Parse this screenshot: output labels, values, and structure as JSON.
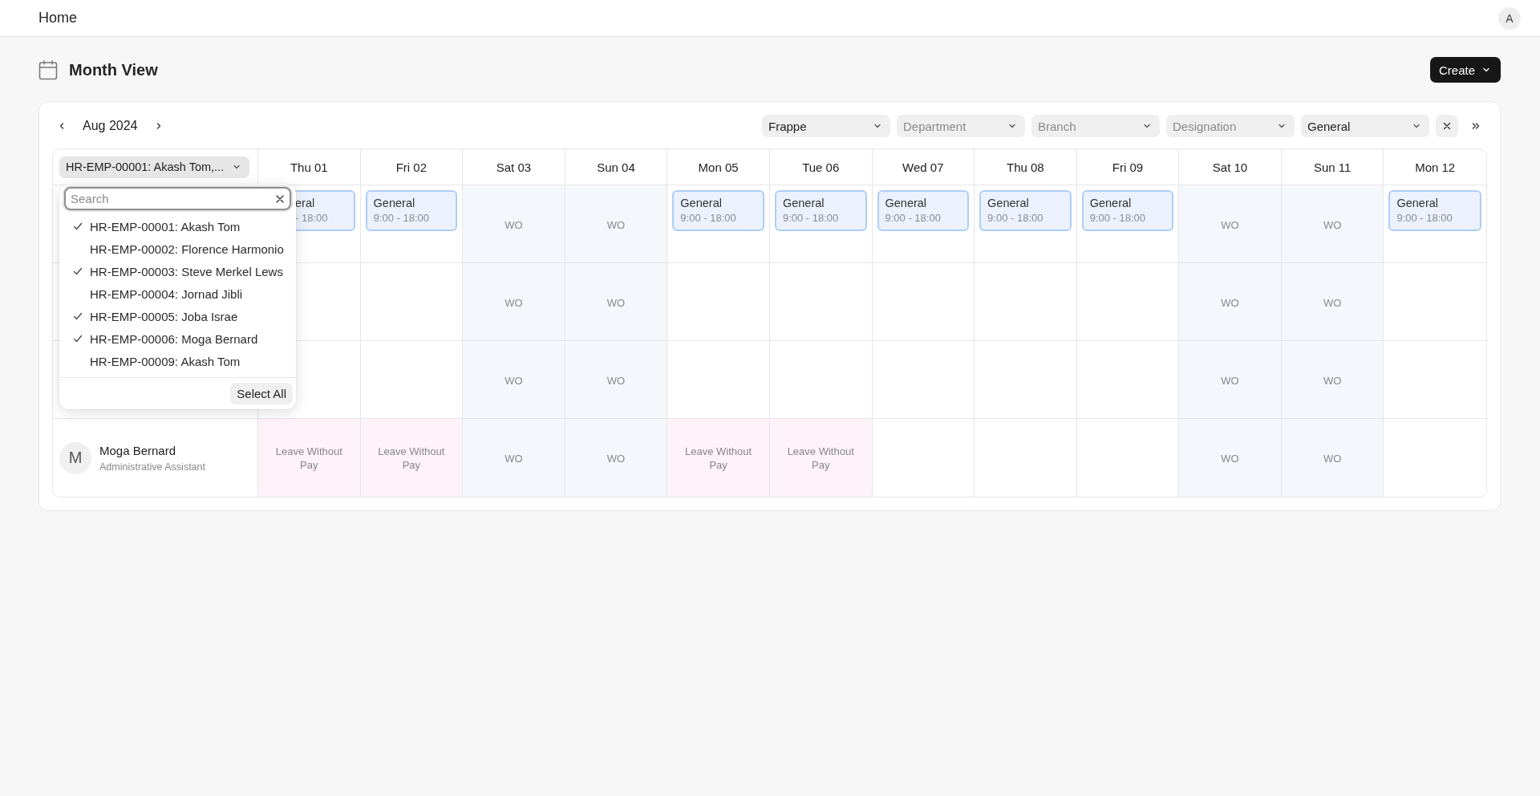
{
  "topbar": {
    "title": "Home",
    "avatar": "A"
  },
  "page": {
    "title": "Month View",
    "create_button": "Create"
  },
  "toolbar": {
    "month": "Aug 2024",
    "filters": [
      {
        "value": "Frappe"
      },
      {
        "placeholder": "Department"
      },
      {
        "placeholder": "Branch"
      },
      {
        "placeholder": "Designation"
      },
      {
        "value": "General"
      }
    ]
  },
  "employee_filter": {
    "value": "HR-EMP-00001: Akash Tom,...",
    "expanded": true,
    "search_placeholder": "Search",
    "options": [
      {
        "label": "HR-EMP-00001: Akash Tom",
        "checked": true
      },
      {
        "label": "HR-EMP-00002: Florence Harmonio",
        "checked": false
      },
      {
        "label": "HR-EMP-00003: Steve Merkel Lews",
        "checked": true
      },
      {
        "label": "HR-EMP-00004: Jornad Jibli",
        "checked": false
      },
      {
        "label": "HR-EMP-00005: Joba Israe",
        "checked": true
      },
      {
        "label": "HR-EMP-00006: Moga Bernard",
        "checked": true
      },
      {
        "label": "HR-EMP-00009: Akash Tom",
        "checked": false
      }
    ],
    "select_all": "Select All"
  },
  "columns": [
    "Thu 01",
    "Fri 02",
    "Sat 03",
    "Sun 04",
    "Mon 05",
    "Tue 06",
    "Wed 07",
    "Thu 08",
    "Fri 09",
    "Sat 10",
    "Sun 11",
    "Mon 12"
  ],
  "rows": [
    {
      "cells": [
        {
          "kind": "shift",
          "label": "eral",
          "time": "- 18:00"
        },
        {
          "kind": "shift",
          "label": "General",
          "time": "9:00 - 18:00"
        },
        {
          "kind": "off",
          "label": "WO"
        },
        {
          "kind": "off",
          "label": "WO"
        },
        {
          "kind": "shift",
          "label": "General",
          "time": "9:00 - 18:00"
        },
        {
          "kind": "shift",
          "label": "General",
          "time": "9:00 - 18:00"
        },
        {
          "kind": "shift",
          "label": "General",
          "time": "9:00 - 18:00"
        },
        {
          "kind": "shift",
          "label": "General",
          "time": "9:00 - 18:00"
        },
        {
          "kind": "shift",
          "label": "General",
          "time": "9:00 - 18:00"
        },
        {
          "kind": "off",
          "label": "WO"
        },
        {
          "kind": "off",
          "label": "WO"
        },
        {
          "kind": "shift",
          "label": "General",
          "time": "9:00 - 18:00"
        }
      ]
    },
    {
      "cells": [
        {
          "kind": "empty"
        },
        {
          "kind": "empty"
        },
        {
          "kind": "off",
          "label": "WO"
        },
        {
          "kind": "off",
          "label": "WO"
        },
        {
          "kind": "empty"
        },
        {
          "kind": "empty"
        },
        {
          "kind": "empty"
        },
        {
          "kind": "empty"
        },
        {
          "kind": "empty"
        },
        {
          "kind": "off",
          "label": "WO"
        },
        {
          "kind": "off",
          "label": "WO"
        },
        {
          "kind": "empty"
        }
      ]
    },
    {
      "cells": [
        {
          "kind": "empty"
        },
        {
          "kind": "empty"
        },
        {
          "kind": "off",
          "label": "WO"
        },
        {
          "kind": "off",
          "label": "WO"
        },
        {
          "kind": "empty"
        },
        {
          "kind": "empty"
        },
        {
          "kind": "empty"
        },
        {
          "kind": "empty"
        },
        {
          "kind": "empty"
        },
        {
          "kind": "off",
          "label": "WO"
        },
        {
          "kind": "off",
          "label": "WO"
        },
        {
          "kind": "empty"
        }
      ]
    },
    {
      "employee": {
        "initial": "M",
        "name": "Moga Bernard",
        "designation": "Administrative Assistant"
      },
      "cells": [
        {
          "kind": "leave",
          "label": "Leave Without Pay"
        },
        {
          "kind": "leave",
          "label": "Leave Without Pay"
        },
        {
          "kind": "off",
          "label": "WO"
        },
        {
          "kind": "off",
          "label": "WO"
        },
        {
          "kind": "leave",
          "label": "Leave Without Pay"
        },
        {
          "kind": "leave",
          "label": "Leave Without Pay"
        },
        {
          "kind": "empty"
        },
        {
          "kind": "empty"
        },
        {
          "kind": "empty"
        },
        {
          "kind": "off",
          "label": "WO"
        },
        {
          "kind": "off",
          "label": "WO"
        },
        {
          "kind": "empty"
        }
      ]
    }
  ]
}
